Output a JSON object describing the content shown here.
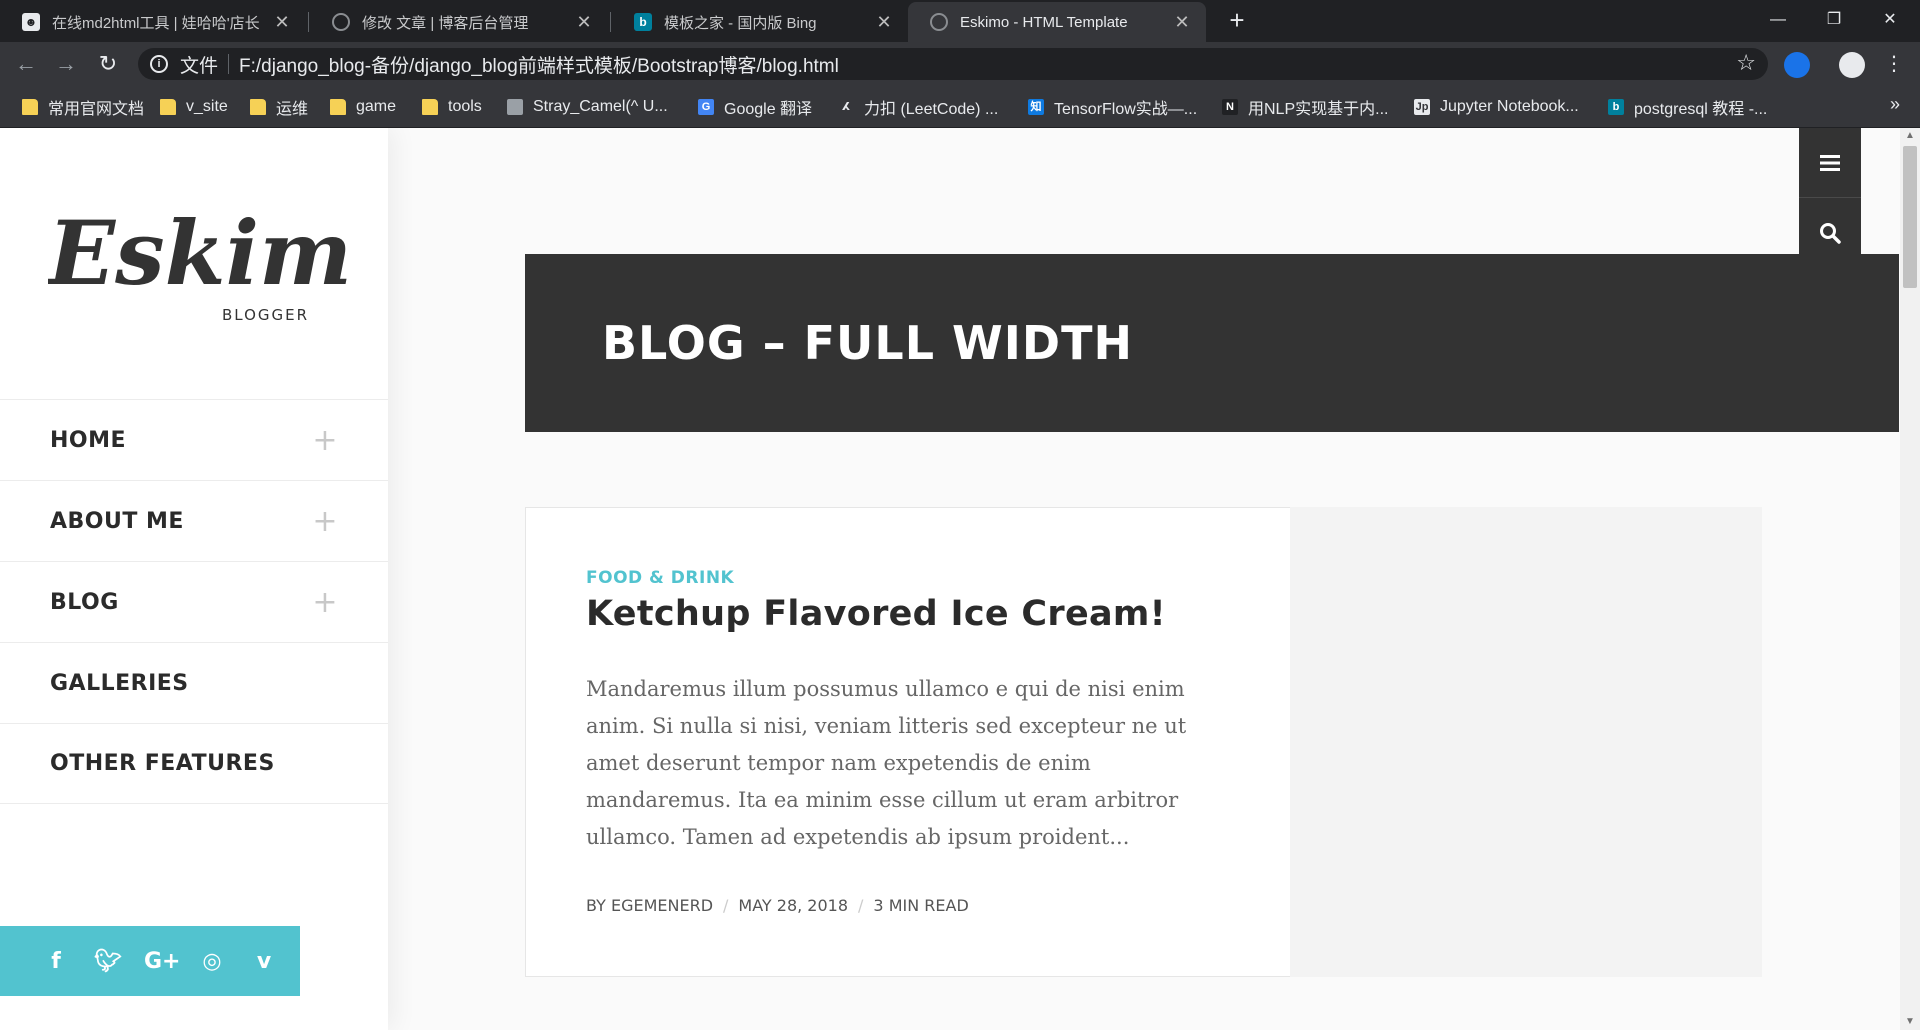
{
  "browser": {
    "tabs": [
      {
        "title": "在线md2html工具 | 娃哈哈'店长",
        "icon": "cat-favicon"
      },
      {
        "title": "修改 文章 | 博客后台管理",
        "icon": "globe-favicon"
      },
      {
        "title": "模板之家 - 国内版 Bing",
        "icon": "bing-favicon"
      },
      {
        "title": "Eskimo - HTML Template",
        "icon": "globe-favicon"
      }
    ],
    "address": {
      "prefix": "文件",
      "url": "F:/django_blog-备份/django_blog前端样式模板/Bootstrap博客/blog.html"
    },
    "bookmarks": [
      {
        "label": "常用官网文档",
        "icon": "folder-icon"
      },
      {
        "label": "v_site",
        "icon": "folder-icon"
      },
      {
        "label": "运维",
        "icon": "folder-icon"
      },
      {
        "label": "game",
        "icon": "folder-icon"
      },
      {
        "label": "tools",
        "icon": "folder-icon"
      },
      {
        "label": "Stray_Camel(^ U...",
        "icon": "site-icon"
      },
      {
        "label": "Google 翻译",
        "icon": "translate-icon"
      },
      {
        "label": "力扣 (LeetCode) ...",
        "icon": "leetcode-icon"
      },
      {
        "label": "TensorFlow实战—...",
        "icon": "zhihu-icon"
      },
      {
        "label": "用NLP实现基于内...",
        "icon": "n-icon"
      },
      {
        "label": "Jupyter Notebook...",
        "icon": "doc-icon"
      },
      {
        "label": "postgresql 教程 -...",
        "icon": "bing-icon"
      }
    ],
    "colors": {
      "chrome_dark": "#202124",
      "chrome_mid": "#35363a"
    }
  },
  "site": {
    "logo": {
      "word": "Eskimo",
      "tagline": "BLOGGER"
    },
    "menu": [
      {
        "label": "HOME",
        "expandable": true
      },
      {
        "label": "ABOUT ME",
        "expandable": true
      },
      {
        "label": "BLOG",
        "expandable": true
      },
      {
        "label": "GALLERIES",
        "expandable": false
      },
      {
        "label": "OTHER FEATURES",
        "expandable": false
      }
    ],
    "social": [
      "facebook-icon",
      "twitter-icon",
      "google-plus-icon",
      "instagram-icon",
      "vimeo-icon"
    ],
    "colors": {
      "accent": "#52c3cf",
      "dark": "#333333"
    }
  },
  "hero": {
    "title": "BLOG – FULL WIDTH"
  },
  "post": {
    "category": "FOOD & DRINK",
    "title": "Ketchup Flavored Ice Cream!",
    "excerpt": "Mandaremus illum possumus ullamco e qui de nisi enim anim. Si nulla si nisi, veniam litteris sed excepteur ne ut amet deserunt tempor nam expetendis de enim mandaremus. Ita ea minim esse cillum ut eram arbitror ullamco. Tamen ad expetendis ab ipsum proident...",
    "author": "BY EGEMENERD",
    "date": "MAY 28, 2018",
    "read_time": "3 MIN READ"
  }
}
